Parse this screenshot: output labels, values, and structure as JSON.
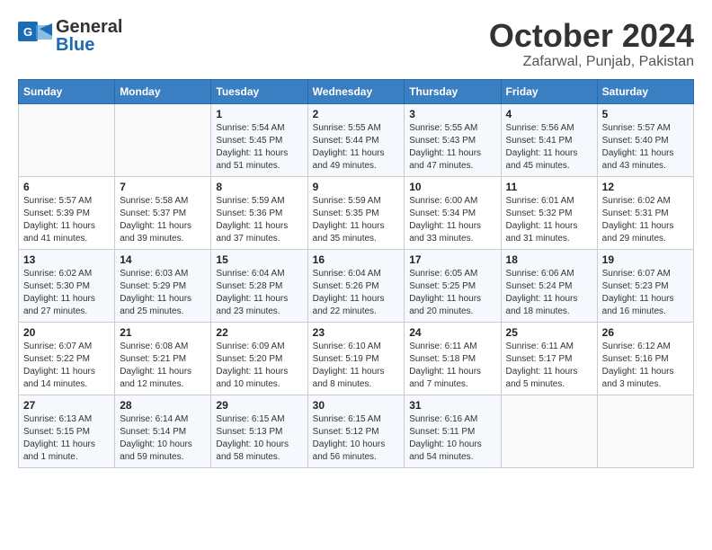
{
  "header": {
    "logo_general": "General",
    "logo_blue": "Blue",
    "month": "October 2024",
    "location": "Zafarwal, Punjab, Pakistan"
  },
  "days_of_week": [
    "Sunday",
    "Monday",
    "Tuesday",
    "Wednesday",
    "Thursday",
    "Friday",
    "Saturday"
  ],
  "weeks": [
    [
      {
        "day": "",
        "detail": ""
      },
      {
        "day": "",
        "detail": ""
      },
      {
        "day": "1",
        "detail": "Sunrise: 5:54 AM\nSunset: 5:45 PM\nDaylight: 11 hours and 51 minutes."
      },
      {
        "day": "2",
        "detail": "Sunrise: 5:55 AM\nSunset: 5:44 PM\nDaylight: 11 hours and 49 minutes."
      },
      {
        "day": "3",
        "detail": "Sunrise: 5:55 AM\nSunset: 5:43 PM\nDaylight: 11 hours and 47 minutes."
      },
      {
        "day": "4",
        "detail": "Sunrise: 5:56 AM\nSunset: 5:41 PM\nDaylight: 11 hours and 45 minutes."
      },
      {
        "day": "5",
        "detail": "Sunrise: 5:57 AM\nSunset: 5:40 PM\nDaylight: 11 hours and 43 minutes."
      }
    ],
    [
      {
        "day": "6",
        "detail": "Sunrise: 5:57 AM\nSunset: 5:39 PM\nDaylight: 11 hours and 41 minutes."
      },
      {
        "day": "7",
        "detail": "Sunrise: 5:58 AM\nSunset: 5:37 PM\nDaylight: 11 hours and 39 minutes."
      },
      {
        "day": "8",
        "detail": "Sunrise: 5:59 AM\nSunset: 5:36 PM\nDaylight: 11 hours and 37 minutes."
      },
      {
        "day": "9",
        "detail": "Sunrise: 5:59 AM\nSunset: 5:35 PM\nDaylight: 11 hours and 35 minutes."
      },
      {
        "day": "10",
        "detail": "Sunrise: 6:00 AM\nSunset: 5:34 PM\nDaylight: 11 hours and 33 minutes."
      },
      {
        "day": "11",
        "detail": "Sunrise: 6:01 AM\nSunset: 5:32 PM\nDaylight: 11 hours and 31 minutes."
      },
      {
        "day": "12",
        "detail": "Sunrise: 6:02 AM\nSunset: 5:31 PM\nDaylight: 11 hours and 29 minutes."
      }
    ],
    [
      {
        "day": "13",
        "detail": "Sunrise: 6:02 AM\nSunset: 5:30 PM\nDaylight: 11 hours and 27 minutes."
      },
      {
        "day": "14",
        "detail": "Sunrise: 6:03 AM\nSunset: 5:29 PM\nDaylight: 11 hours and 25 minutes."
      },
      {
        "day": "15",
        "detail": "Sunrise: 6:04 AM\nSunset: 5:28 PM\nDaylight: 11 hours and 23 minutes."
      },
      {
        "day": "16",
        "detail": "Sunrise: 6:04 AM\nSunset: 5:26 PM\nDaylight: 11 hours and 22 minutes."
      },
      {
        "day": "17",
        "detail": "Sunrise: 6:05 AM\nSunset: 5:25 PM\nDaylight: 11 hours and 20 minutes."
      },
      {
        "day": "18",
        "detail": "Sunrise: 6:06 AM\nSunset: 5:24 PM\nDaylight: 11 hours and 18 minutes."
      },
      {
        "day": "19",
        "detail": "Sunrise: 6:07 AM\nSunset: 5:23 PM\nDaylight: 11 hours and 16 minutes."
      }
    ],
    [
      {
        "day": "20",
        "detail": "Sunrise: 6:07 AM\nSunset: 5:22 PM\nDaylight: 11 hours and 14 minutes."
      },
      {
        "day": "21",
        "detail": "Sunrise: 6:08 AM\nSunset: 5:21 PM\nDaylight: 11 hours and 12 minutes."
      },
      {
        "day": "22",
        "detail": "Sunrise: 6:09 AM\nSunset: 5:20 PM\nDaylight: 11 hours and 10 minutes."
      },
      {
        "day": "23",
        "detail": "Sunrise: 6:10 AM\nSunset: 5:19 PM\nDaylight: 11 hours and 8 minutes."
      },
      {
        "day": "24",
        "detail": "Sunrise: 6:11 AM\nSunset: 5:18 PM\nDaylight: 11 hours and 7 minutes."
      },
      {
        "day": "25",
        "detail": "Sunrise: 6:11 AM\nSunset: 5:17 PM\nDaylight: 11 hours and 5 minutes."
      },
      {
        "day": "26",
        "detail": "Sunrise: 6:12 AM\nSunset: 5:16 PM\nDaylight: 11 hours and 3 minutes."
      }
    ],
    [
      {
        "day": "27",
        "detail": "Sunrise: 6:13 AM\nSunset: 5:15 PM\nDaylight: 11 hours and 1 minute."
      },
      {
        "day": "28",
        "detail": "Sunrise: 6:14 AM\nSunset: 5:14 PM\nDaylight: 10 hours and 59 minutes."
      },
      {
        "day": "29",
        "detail": "Sunrise: 6:15 AM\nSunset: 5:13 PM\nDaylight: 10 hours and 58 minutes."
      },
      {
        "day": "30",
        "detail": "Sunrise: 6:15 AM\nSunset: 5:12 PM\nDaylight: 10 hours and 56 minutes."
      },
      {
        "day": "31",
        "detail": "Sunrise: 6:16 AM\nSunset: 5:11 PM\nDaylight: 10 hours and 54 minutes."
      },
      {
        "day": "",
        "detail": ""
      },
      {
        "day": "",
        "detail": ""
      }
    ]
  ]
}
